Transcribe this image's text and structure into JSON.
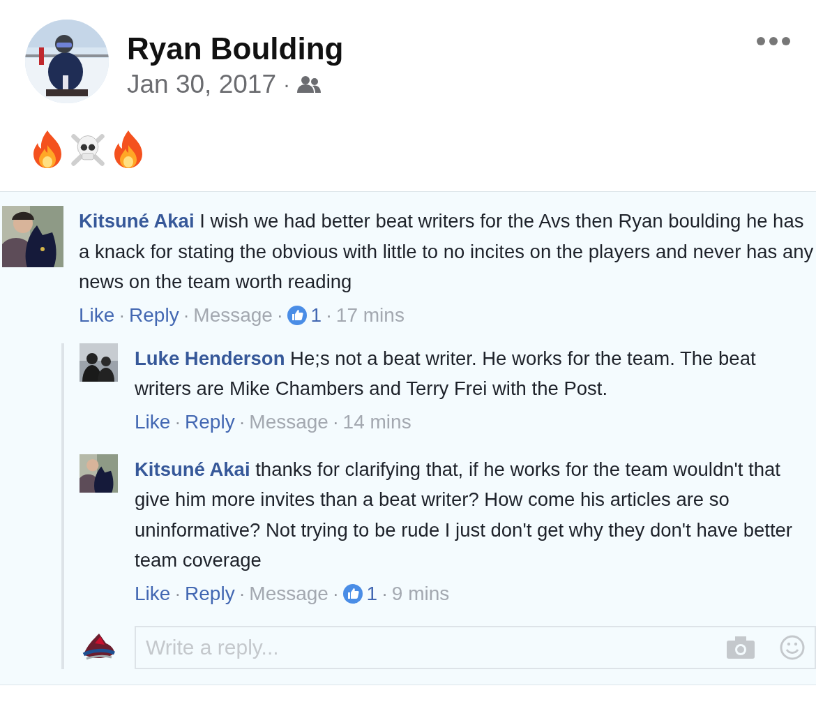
{
  "post": {
    "author": "Ryan Boulding",
    "date": "Jan 30, 2017",
    "separator": "·",
    "emoji": [
      {
        "kind": "fire"
      },
      {
        "kind": "skull"
      },
      {
        "kind": "fire"
      }
    ]
  },
  "separator": "·",
  "comments": [
    {
      "author": "Kitsuné Akai",
      "text": "I wish we had better beat writers for the Avs then Ryan boulding he has a knack for stating the obvious with little to no incites on the players and never has any news on the team worth reading",
      "actions": [
        {
          "label": "Like",
          "kind": "link"
        },
        {
          "label": "Reply",
          "kind": "link"
        },
        {
          "label": "Message",
          "kind": "muted"
        }
      ],
      "likes": "1",
      "time": "17 mins",
      "replies": [
        {
          "author": "Luke Henderson",
          "text": "He;s not a beat writer. He works for the team. The beat writers are Mike Chambers and Terry Frei with the Post.",
          "actions": [
            {
              "label": "Like",
              "kind": "link"
            },
            {
              "label": "Reply",
              "kind": "link"
            },
            {
              "label": "Message",
              "kind": "muted"
            }
          ],
          "time": "14 mins"
        },
        {
          "author": "Kitsuné Akai",
          "text": "thanks for clarifying that, if he works for the team wouldn't that give him more invites than a beat writer? How come his articles are so uninformative? Not trying to be rude I just don't get why they don't have better team coverage",
          "actions": [
            {
              "label": "Like",
              "kind": "link"
            },
            {
              "label": "Reply",
              "kind": "link"
            },
            {
              "label": "Message",
              "kind": "muted"
            }
          ],
          "likes": "1",
          "time": "9 mins"
        }
      ],
      "reply_box": {
        "placeholder": "Write a reply..."
      }
    }
  ]
}
